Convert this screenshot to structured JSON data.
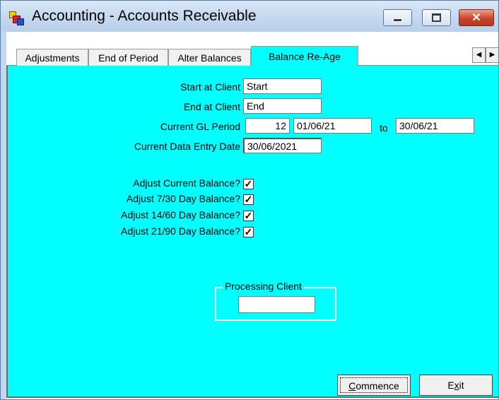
{
  "window": {
    "title": "Accounting - Accounts Receivable",
    "controls": {
      "minimize": "minimize-icon",
      "maximize": "maximize-icon",
      "close": "close-icon"
    },
    "close_glyph": "✕"
  },
  "tabs": [
    {
      "label": "Adjustments",
      "active": false
    },
    {
      "label": "End of Period",
      "active": false
    },
    {
      "label": "Alter Balances",
      "active": false
    },
    {
      "label": "Balance Re-Age",
      "active": true
    }
  ],
  "tab_scroll": {
    "left_glyph": "◀",
    "right_glyph": "▶"
  },
  "form": {
    "start_client": {
      "label": "Start at Client",
      "value": "Start"
    },
    "end_client": {
      "label": "End at Client",
      "value": "End"
    },
    "gl_period": {
      "label": "Current GL Period",
      "period": "12",
      "from": "01/06/21",
      "to_label": "to",
      "to": "30/06/21"
    },
    "entry_date": {
      "label": "Current Data Entry Date",
      "value": "30/06/2021"
    },
    "checks": [
      {
        "label": "Adjust Current Balance?",
        "checked": true
      },
      {
        "label": "Adjust 7/30 Day Balance?",
        "checked": true
      },
      {
        "label": "Adjust 14/60 Day Balance?",
        "checked": true
      },
      {
        "label": "Adjust 21/90 Day Balance?",
        "checked": true
      }
    ],
    "check_glyph": "✓"
  },
  "processing": {
    "title": "Processing Client",
    "value": ""
  },
  "buttons": {
    "commence": {
      "pre": "",
      "mnemonic": "C",
      "post": "ommence"
    },
    "exit": {
      "pre": "E",
      "mnemonic": "x",
      "post": "it"
    }
  },
  "colors": {
    "panel": "#00ffff",
    "title_bar": "#c4d8ef",
    "close_button": "#c9452b"
  }
}
